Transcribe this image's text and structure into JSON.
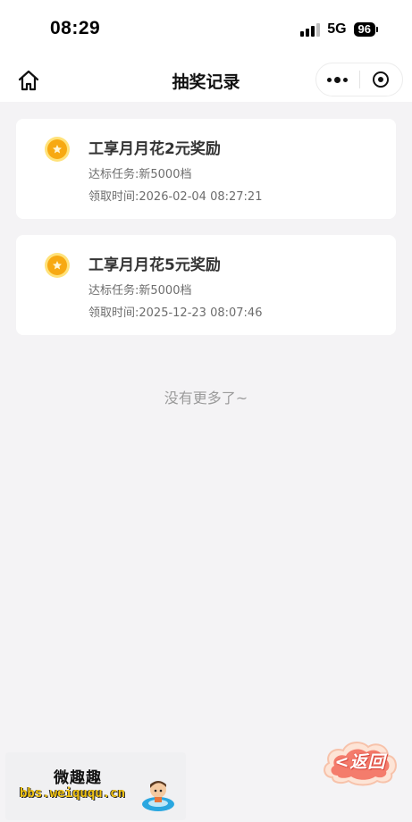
{
  "status_bar": {
    "time": "08:29",
    "network": "5G",
    "battery": "96"
  },
  "nav": {
    "title": "抽奖记录",
    "home_icon": "home-icon",
    "more_icon": "more-dots-icon",
    "close_icon": "target-close-icon"
  },
  "records": [
    {
      "title": "工享月月花2元奖励",
      "task_label": "达标任务:",
      "task_value": "新5000档",
      "time_label": "领取时间:",
      "time_value": "2026-02-04 08:27:21"
    },
    {
      "title": "工享月月花5元奖励",
      "task_label": "达标任务:",
      "task_value": "新5000档",
      "time_label": "领取时间:",
      "time_value": "2025-12-23 08:07:46"
    }
  ],
  "footer": {
    "no_more": "没有更多了~"
  },
  "watermark": {
    "name_cn": "微趣趣",
    "url": "bbs.weiququ.cn"
  },
  "float": {
    "back_label": "<返回"
  },
  "colors": {
    "background": "#f4f3f5",
    "card": "#ffffff",
    "coin_outer": "#ffe27a",
    "coin_inner": "#f7a912",
    "back_accent": "#d9473e"
  }
}
